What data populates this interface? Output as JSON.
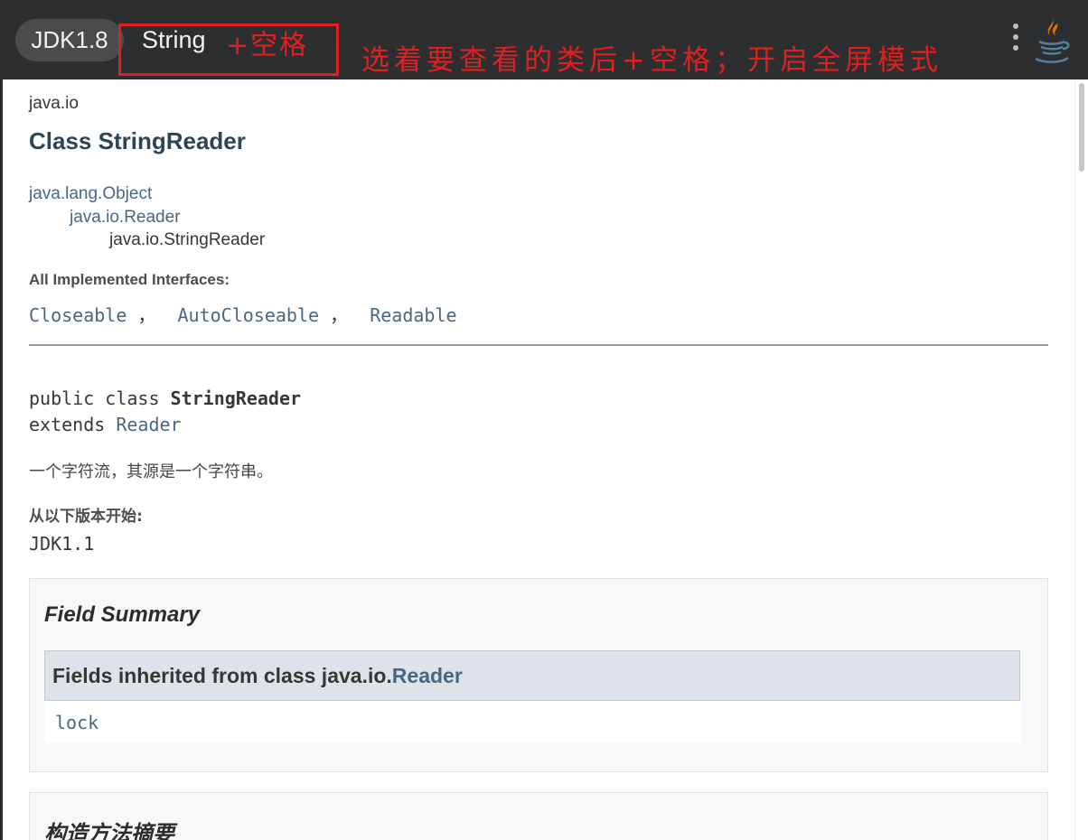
{
  "topbar": {
    "version_badge": "JDK1.8",
    "search_query": "String",
    "hint_shortcut": "+空格",
    "hint_note": "选着要查看的类后+空格；开启全屏模式",
    "menu_icon": "more-vertical-icon",
    "logo_icon": "java-cup-icon",
    "hint_color": "#e02020"
  },
  "doc": {
    "package": "java.io",
    "class_title": "Class StringReader",
    "hierarchy": [
      "java.lang.Object",
      "java.io.Reader",
      "java.io.StringReader"
    ],
    "implemented_label": "All Implemented Interfaces:",
    "interfaces": [
      "Closeable",
      "AutoCloseable",
      "Readable"
    ],
    "interface_separator": " ，",
    "signature": {
      "modifiers": "public class ",
      "name": "StringReader",
      "extends_kw": "extends ",
      "extends_class": "Reader"
    },
    "description": "一个字符流，其源是一个字符串。",
    "since_label": "从以下版本开始:",
    "since_value": "JDK1.1"
  },
  "field_summary": {
    "title": "Field Summary",
    "inherited_prefix": "Fields inherited from class java.io.",
    "inherited_class": "Reader",
    "fields": [
      "lock"
    ]
  },
  "constructor_summary": {
    "title": "构造方法摘要"
  },
  "colors": {
    "link": "#4a6782",
    "title": "#2c4557",
    "topbar": "#2d2e30"
  }
}
